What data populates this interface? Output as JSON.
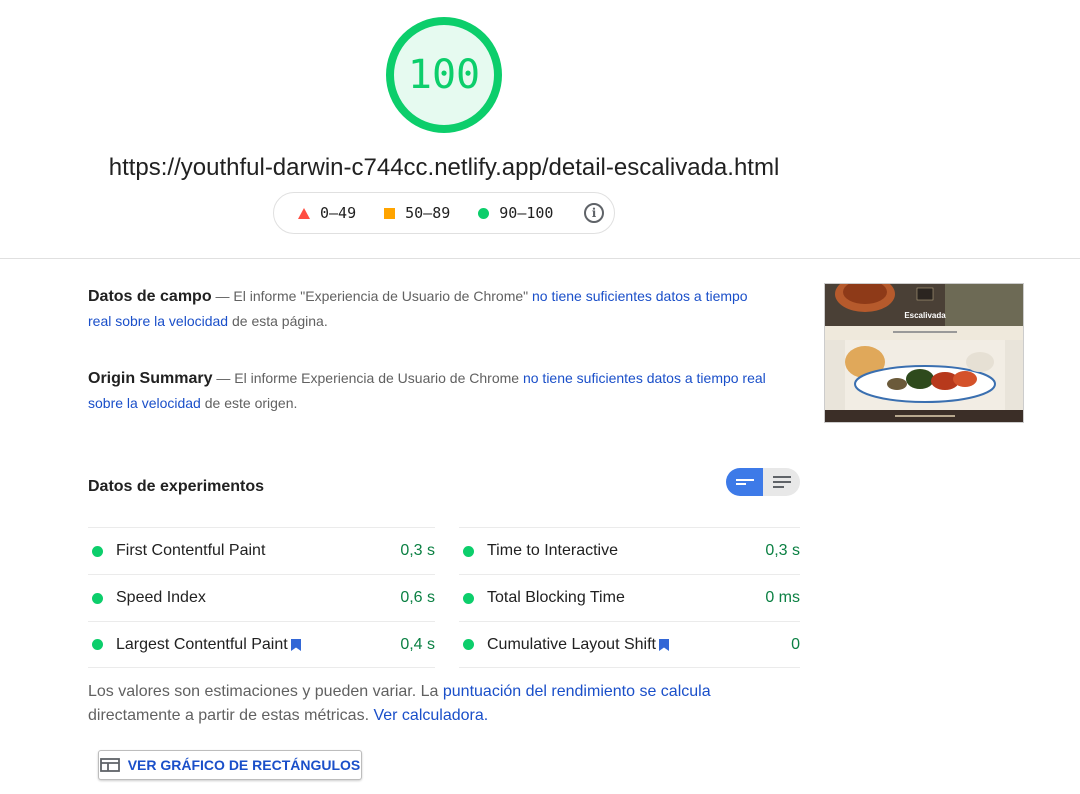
{
  "score": {
    "value": "100",
    "fraction": 1.0,
    "color": "#0cce6b"
  },
  "url": "https://youthful-darwin-c744cc.netlify.app/detail-escalivada.html",
  "legend": {
    "fail": "0–49",
    "average": "50–89",
    "pass": "90–100"
  },
  "field_data": {
    "title": "Datos de campo",
    "text_before": "— El informe \"Experiencia de Usuario de Chrome\"",
    "link": "no tiene suficientes datos a tiempo real sobre la velocidad",
    "text_after": "de esta página."
  },
  "origin_summary": {
    "title": "Origin Summary",
    "text_before": "— El informe Experiencia de Usuario de Chrome",
    "link": "no tiene suficientes datos a tiempo real sobre la velocidad",
    "text_after": "de este origen."
  },
  "thumbnail": {
    "site_title": "Escalivada"
  },
  "lab_data": {
    "title": "Datos de experimentos",
    "metrics_left": [
      {
        "name": "First Contentful Paint",
        "value": "0,3 s"
      },
      {
        "name": "Speed Index",
        "value": "0,6 s"
      },
      {
        "name": "Largest Contentful Paint",
        "value": "0,4 s"
      }
    ],
    "metrics_right": [
      {
        "name": "Time to Interactive",
        "value": "0,3 s"
      },
      {
        "name": "Total Blocking Time",
        "value": "0 ms"
      },
      {
        "name": "Cumulative Layout Shift",
        "value": "0"
      }
    ]
  },
  "notes": {
    "text1": "Los valores son estimaciones y pueden variar. La",
    "link1": "puntuación del rendimiento se calcula",
    "text2": "directamente a partir de estas métricas.",
    "link2": "Ver calculadora."
  },
  "treemap_button": "VER GRÁFICO DE RECTÁNGULOS",
  "colors": {
    "pass": "#0cce6b",
    "average": "#ffa400",
    "fail": "#ff4e42",
    "link": "#1a4fc9",
    "pass_text": "#0b8043"
  }
}
